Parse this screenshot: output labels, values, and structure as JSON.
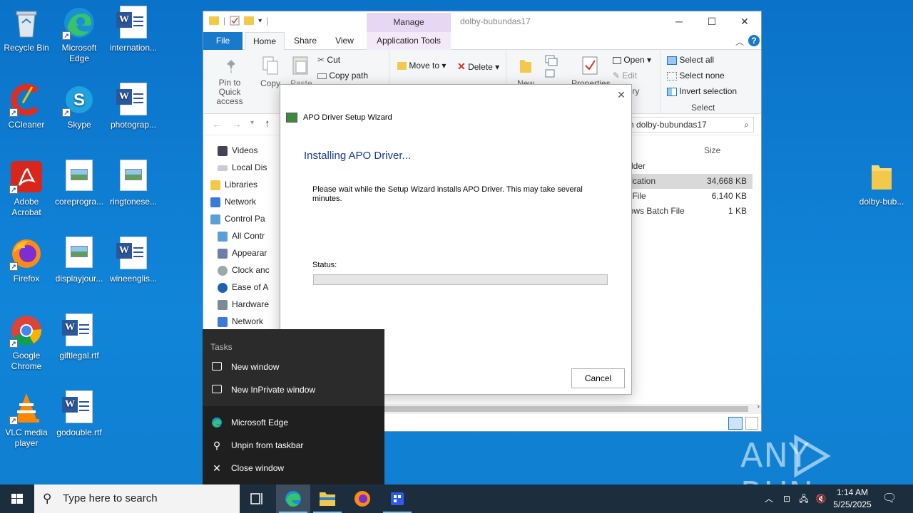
{
  "desktop": {
    "icons": [
      {
        "label": "Recycle Bin"
      },
      {
        "label": "Microsoft Edge"
      },
      {
        "label": "internation..."
      },
      {
        "label": "CCleaner"
      },
      {
        "label": "Skype"
      },
      {
        "label": "photograp..."
      },
      {
        "label": "Adobe Acrobat"
      },
      {
        "label": "coreprogra..."
      },
      {
        "label": "ringtonese..."
      },
      {
        "label": "Firefox"
      },
      {
        "label": "displayjour..."
      },
      {
        "label": "wineenglis..."
      },
      {
        "label": "Google Chrome"
      },
      {
        "label": "giftlegal.rtf"
      },
      {
        "label": "VLC media player"
      },
      {
        "label": "godouble.rtf"
      },
      {
        "label": "dolby-bub..."
      }
    ]
  },
  "explorer": {
    "title": "dolby-bubundas17",
    "contextual_tab_group": "Manage",
    "tabs": {
      "file": "File",
      "home": "Home",
      "share": "Share",
      "view": "View",
      "app_tools": "Application Tools"
    },
    "ribbon": {
      "pin": "Pin to Quick access",
      "copy": "Copy",
      "paste": "Paste",
      "cut": "Cut",
      "copy_path": "Copy path",
      "move_to": "Move to",
      "delete": "Delete",
      "new": "New",
      "properties": "Properties",
      "open": "Open",
      "edit": "Edit",
      "history": "History",
      "select_all": "Select all",
      "select_none": "Select none",
      "invert_selection": "Invert selection",
      "select_group": "Select"
    },
    "search_placeholder": "Search dolby-bubundas17",
    "search_visible": "ch dolby-bubundas17",
    "tree": [
      {
        "label": "Videos"
      },
      {
        "label": "Local Dis"
      },
      {
        "label": "Libraries"
      },
      {
        "label": "Network"
      },
      {
        "label": "Control Pa"
      },
      {
        "label": "All Contr"
      },
      {
        "label": "Appearar"
      },
      {
        "label": "Clock anc"
      },
      {
        "label": "Ease of A"
      },
      {
        "label": "Hardware"
      },
      {
        "label": "Network"
      }
    ],
    "columns": {
      "type": "e",
      "size": "Size"
    },
    "files": [
      {
        "type": "folder",
        "size": ""
      },
      {
        "type": "plication",
        "size": "34,668 KB"
      },
      {
        "type": "X File",
        "size": "6,140 KB"
      },
      {
        "type": "dows Batch File",
        "size": "1 KB"
      }
    ]
  },
  "dialog": {
    "title": "APO Driver Setup Wizard",
    "heading": "Installing APO Driver...",
    "message": "Please wait while the Setup Wizard installs APO Driver.  This may take several minutes.",
    "status_label": "Status:",
    "progress": 0,
    "cancel": "Cancel"
  },
  "jumplist": {
    "header": "Tasks",
    "items": [
      {
        "label": "New window",
        "icon": "window-icon"
      },
      {
        "label": "New InPrivate window",
        "icon": "inprivate-icon"
      },
      {
        "label": "Microsoft Edge",
        "icon": "edge-icon"
      },
      {
        "label": "Unpin from taskbar",
        "icon": "unpin-icon"
      },
      {
        "label": "Close window",
        "icon": "close-icon"
      }
    ]
  },
  "taskbar": {
    "search_placeholder": "Type here to search",
    "time": "1:14 AM",
    "date": "5/25/2025"
  },
  "watermark": "ANY RUN",
  "colors": {
    "desktop": "#0a72c9",
    "accent": "#1979ca",
    "progress_fill": "#06b025",
    "jumplist_bg": "#2b2b2b",
    "taskbar_bg": "#1c2e3e"
  }
}
